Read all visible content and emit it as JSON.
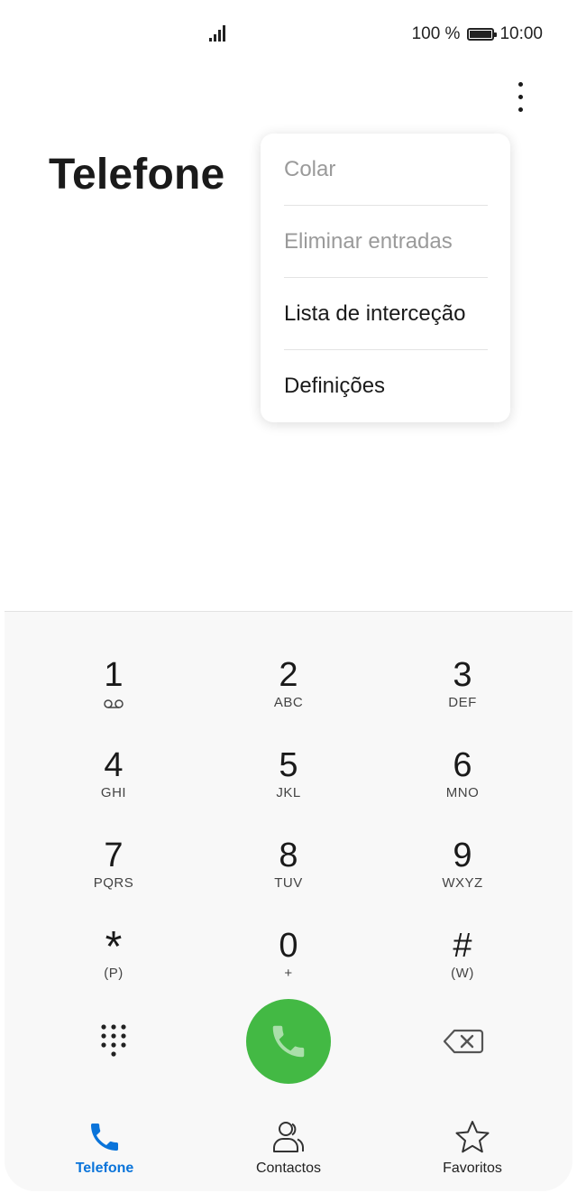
{
  "status_bar": {
    "battery_text": "100 %",
    "battery_level": 100,
    "time": "10:00",
    "signal_icon": "signal-icon",
    "battery_icon": "battery-icon"
  },
  "header": {
    "title": "Telefone",
    "more_icon": "more-vertical-icon"
  },
  "menu": {
    "items": [
      {
        "label": "Colar",
        "enabled": false
      },
      {
        "label": "Eliminar entradas",
        "enabled": false
      },
      {
        "label": "Lista de interceção",
        "enabled": true
      },
      {
        "label": "Definições",
        "enabled": true
      }
    ]
  },
  "dialpad": {
    "keys": [
      {
        "digit": "1",
        "letters": ""
      },
      {
        "digit": "2",
        "letters": "ABC"
      },
      {
        "digit": "3",
        "letters": "DEF"
      },
      {
        "digit": "4",
        "letters": "GHI"
      },
      {
        "digit": "5",
        "letters": "JKL"
      },
      {
        "digit": "6",
        "letters": "MNO"
      },
      {
        "digit": "7",
        "letters": "PQRS"
      },
      {
        "digit": "8",
        "letters": "TUV"
      },
      {
        "digit": "9",
        "letters": "WXYZ"
      },
      {
        "digit": "*",
        "letters": "(P)"
      },
      {
        "digit": "0",
        "letters": "+"
      },
      {
        "digit": "#",
        "letters": "(W)"
      }
    ],
    "call_color": "#43b944"
  },
  "nav": {
    "items": [
      {
        "label": "Telefone",
        "icon": "phone-icon",
        "active": true
      },
      {
        "label": "Contactos",
        "icon": "contacts-icon",
        "active": false
      },
      {
        "label": "Favoritos",
        "icon": "star-icon",
        "active": false
      }
    ],
    "active_color": "#0a74da"
  }
}
